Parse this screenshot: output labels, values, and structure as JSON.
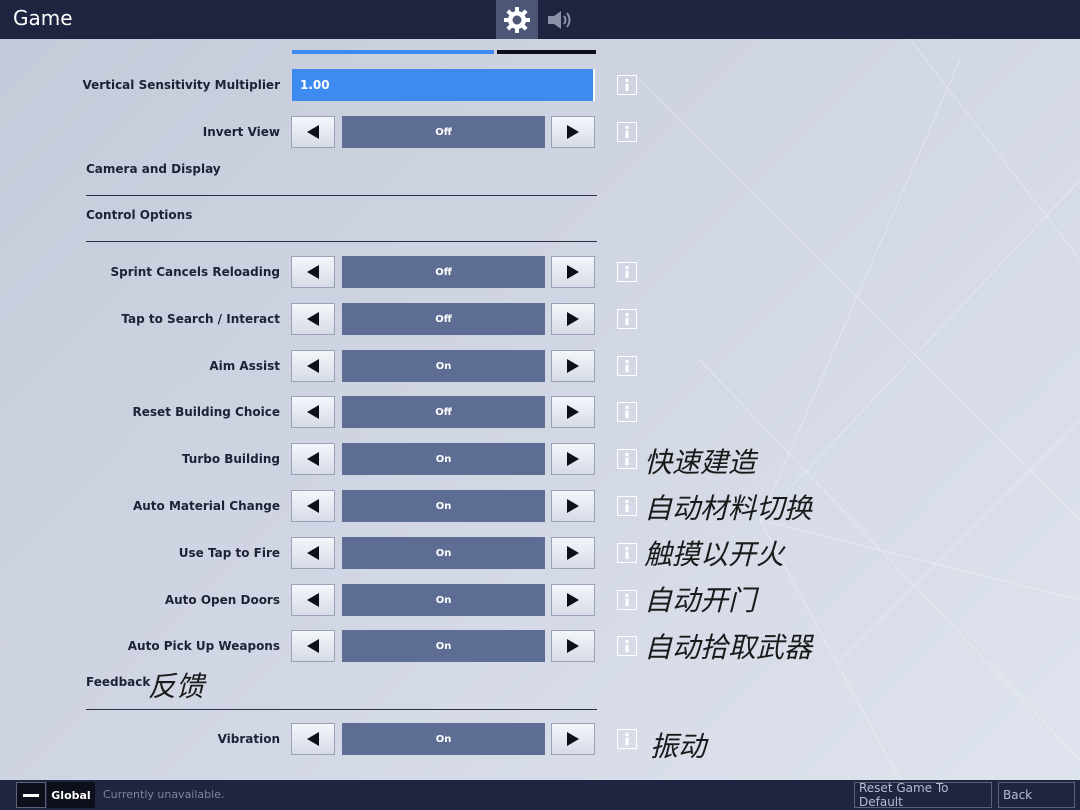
{
  "window": {
    "title": "Game"
  },
  "tabs": [
    {
      "name": "gear-icon",
      "active": true
    },
    {
      "name": "speaker-icon",
      "active": false
    }
  ],
  "sensitivity": {
    "label": "Vertical Sensitivity Multiplier",
    "value": "1.00"
  },
  "invert_view": {
    "label": "Invert View",
    "value": "Off"
  },
  "sections": {
    "camera": "Camera and Display",
    "control": "Control Options",
    "feedback": "Feedback"
  },
  "controls": [
    {
      "label": "Sprint Cancels Reloading",
      "value": "Off"
    },
    {
      "label": "Tap to Search / Interact",
      "value": "Off"
    },
    {
      "label": "Aim Assist",
      "value": "On"
    },
    {
      "label": "Reset Building Choice",
      "value": "Off"
    },
    {
      "label": "Turbo Building",
      "value": "On"
    },
    {
      "label": "Auto Material Change",
      "value": "On"
    },
    {
      "label": "Use Tap to Fire",
      "value": "On"
    },
    {
      "label": "Auto Open Doors",
      "value": "On"
    },
    {
      "label": "Auto Pick Up Weapons",
      "value": "On"
    }
  ],
  "vibration": {
    "label": "Vibration",
    "value": "On"
  },
  "annotations": {
    "turbo_building": "快速建造",
    "auto_material": "自动材料切换",
    "tap_to_fire": "触摸以开火",
    "auto_doors": "自动开门",
    "auto_pickup": "自动拾取武器",
    "feedback": "反馈",
    "vibration": "振动"
  },
  "footer": {
    "global": "Global",
    "status": "Currently unavailable.",
    "reset": "Reset Game To Default",
    "back": "Back"
  },
  "colors": {
    "topbar": "#1f2440",
    "accent": "#3d8bf0",
    "value_box": "#5e6d93"
  }
}
